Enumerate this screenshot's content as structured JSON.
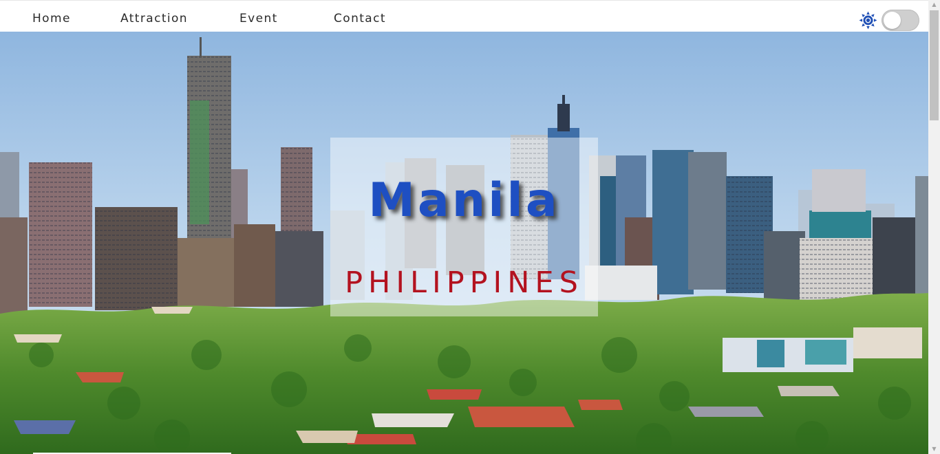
{
  "nav": {
    "items": [
      {
        "label": "Home"
      },
      {
        "label": "Attraction"
      },
      {
        "label": "Event"
      },
      {
        "label": "Contact"
      }
    ],
    "theme_icon": "sun-icon",
    "theme_toggle": {
      "on": false
    }
  },
  "hero": {
    "city": "Manila",
    "country": "PHILIPPINES",
    "background": "city-skyline-photo"
  },
  "colors": {
    "city_title": "#1e4fc2",
    "country_title": "#b3121f",
    "theme_icon": "#1f4fb5",
    "toggle_track": "#cfcfcf"
  },
  "scrollbar": {
    "up_icon": "chevron-up-icon",
    "down_icon": "chevron-down-icon"
  }
}
